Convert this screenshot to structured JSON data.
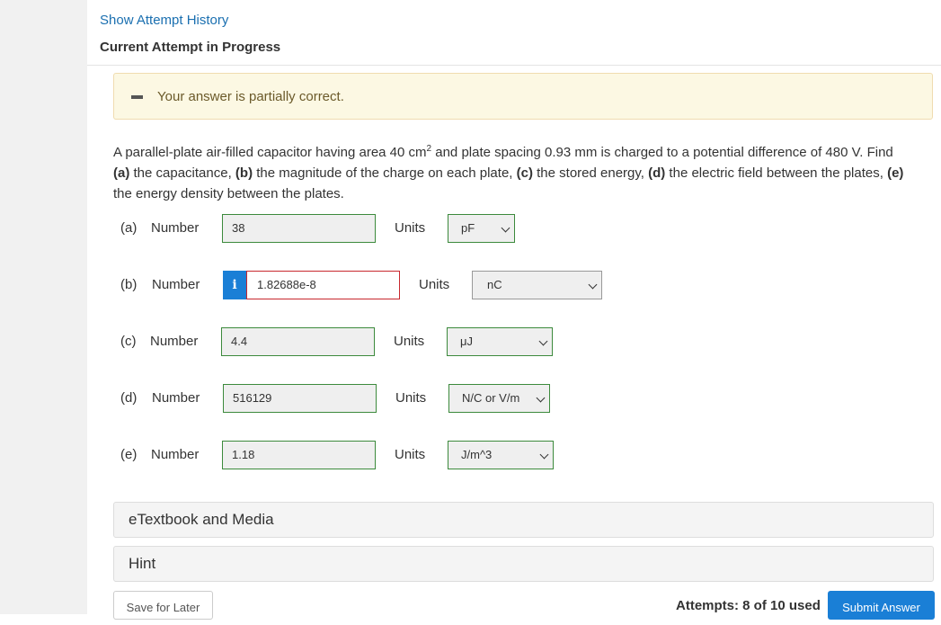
{
  "header": {
    "history_link": "Show Attempt History",
    "attempt_title": "Current Attempt in Progress"
  },
  "banner": {
    "status_icon": "minus-icon",
    "message": "Your answer is partially correct.",
    "background_color": "#fcf8e3"
  },
  "question": {
    "text_before_sup": "A parallel-plate air-filled capacitor having area 40 cm",
    "superscript": "2",
    "text_after_sup": " and plate spacing 0.93 mm is charged to a potential difference of 480 V. Find ",
    "parts": [
      {
        "tag": "(a)",
        "desc": " the capacitance, "
      },
      {
        "tag": "(b)",
        "desc": " the magnitude of the charge on each plate, "
      },
      {
        "tag": "(c)",
        "desc": " the stored energy, "
      },
      {
        "tag": "(d)",
        "desc": " the electric field between the plates, "
      },
      {
        "tag": "(e)",
        "desc": " the energy density between the plates."
      }
    ]
  },
  "answers": [
    {
      "part": "(a)",
      "label": "Number",
      "value": "38",
      "units_label": "Units",
      "unit": "pF",
      "status": "correct"
    },
    {
      "part": "(b)",
      "label": "Number",
      "value": "1.82688e-8",
      "units_label": "Units",
      "unit": "nC",
      "status": "incorrect",
      "info_icon": "info-icon"
    },
    {
      "part": "(c)",
      "label": "Number",
      "value": "4.4",
      "units_label": "Units",
      "unit": "μJ",
      "status": "correct"
    },
    {
      "part": "(d)",
      "label": "Number",
      "value": "516129",
      "units_label": "Units",
      "unit": "N/C or V/m",
      "status": "correct"
    },
    {
      "part": "(e)",
      "label": "Number",
      "value": "1.18",
      "units_label": "Units",
      "unit": "J/m^3",
      "status": "correct"
    }
  ],
  "panels": {
    "etextbook": "eTextbook and Media",
    "hint": "Hint"
  },
  "footer": {
    "save_label": "Save for Later",
    "attempts_text": "Attempts: 8 of 10 used",
    "submit_label": "Submit Answer"
  },
  "colors": {
    "accent": "#1a7fd6",
    "correct_border": "#3c8a3c",
    "incorrect_border": "#c8282e",
    "link": "#1a6fb0"
  }
}
